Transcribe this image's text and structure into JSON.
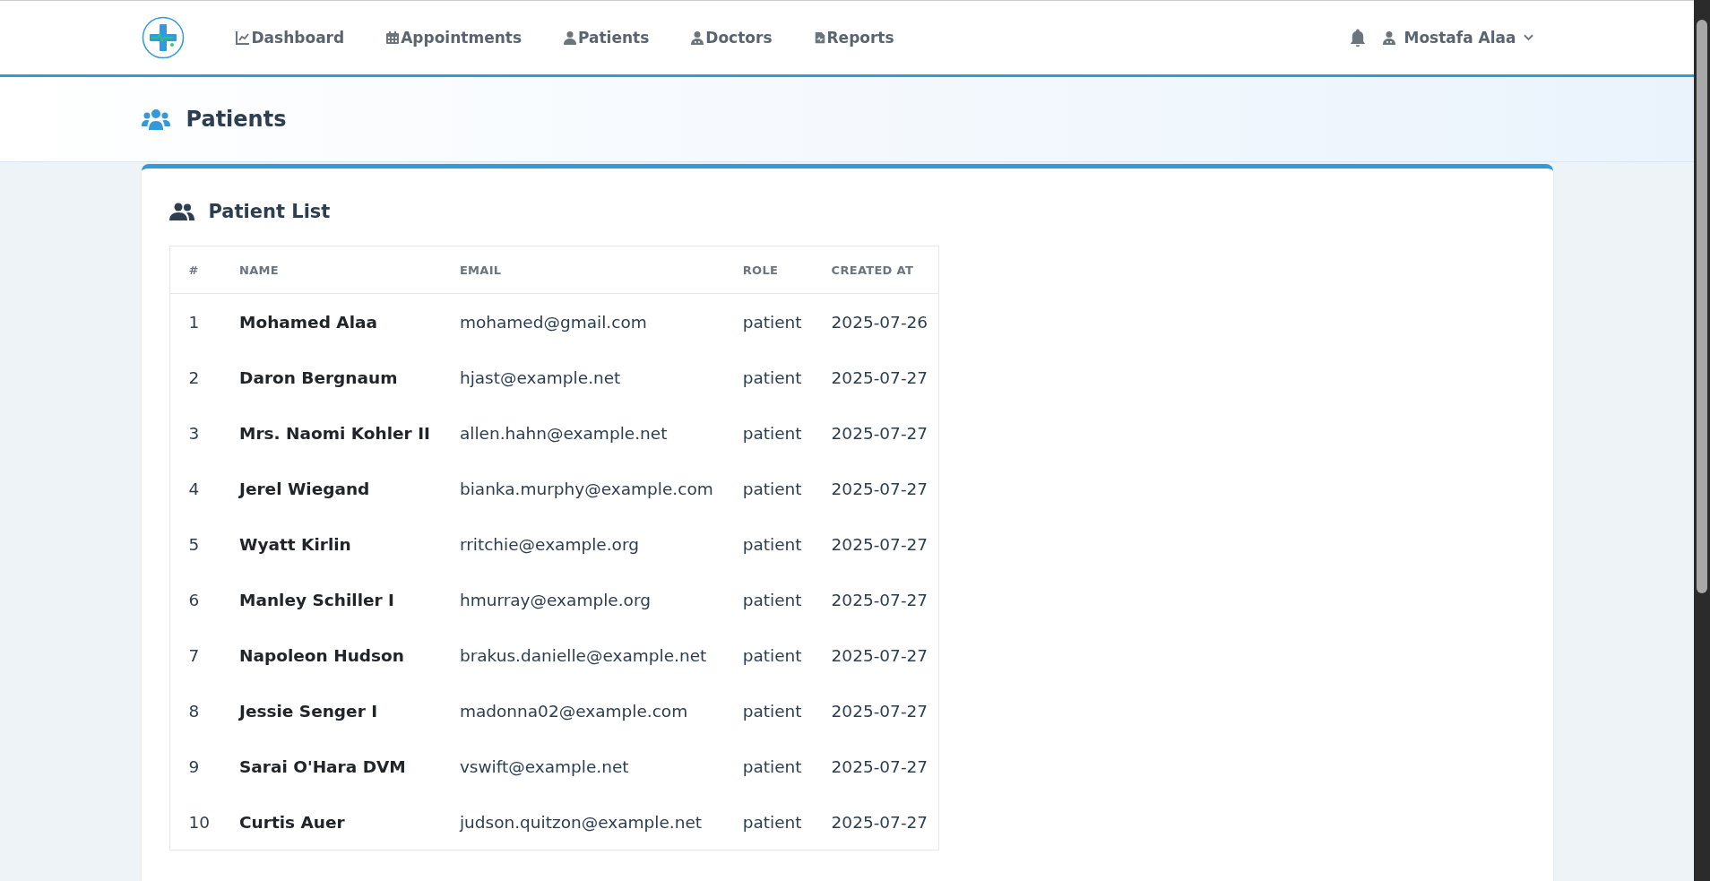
{
  "navbar": {
    "items": [
      {
        "label": "Dashboard"
      },
      {
        "label": "Appointments"
      },
      {
        "label": "Patients"
      },
      {
        "label": "Doctors"
      },
      {
        "label": "Reports"
      }
    ],
    "user": {
      "name": "Mostafa Alaa"
    }
  },
  "page_header": {
    "title": "Patients"
  },
  "card": {
    "title": "Patient List",
    "table": {
      "columns": [
        "#",
        "NAME",
        "EMAIL",
        "ROLE",
        "CREATED AT"
      ],
      "rows": [
        [
          "1",
          "Mohamed Alaa",
          "mohamed@gmail.com",
          "patient",
          "2025-07-26"
        ],
        [
          "2",
          "Daron Bergnaum",
          "hjast@example.net",
          "patient",
          "2025-07-27"
        ],
        [
          "3",
          "Mrs. Naomi Kohler II",
          "allen.hahn@example.net",
          "patient",
          "2025-07-27"
        ],
        [
          "4",
          "Jerel Wiegand",
          "bianka.murphy@example.com",
          "patient",
          "2025-07-27"
        ],
        [
          "5",
          "Wyatt Kirlin",
          "rritchie@example.org",
          "patient",
          "2025-07-27"
        ],
        [
          "6",
          "Manley Schiller I",
          "hmurray@example.org",
          "patient",
          "2025-07-27"
        ],
        [
          "7",
          "Napoleon Hudson",
          "brakus.danielle@example.net",
          "patient",
          "2025-07-27"
        ],
        [
          "8",
          "Jessie Senger I",
          "madonna02@example.com",
          "patient",
          "2025-07-27"
        ],
        [
          "9",
          "Sarai O'Hara DVM",
          "vswift@example.net",
          "patient",
          "2025-07-27"
        ],
        [
          "10",
          "Curtis Auer",
          "judson.quitzon@example.net",
          "patient",
          "2025-07-27"
        ]
      ]
    }
  }
}
